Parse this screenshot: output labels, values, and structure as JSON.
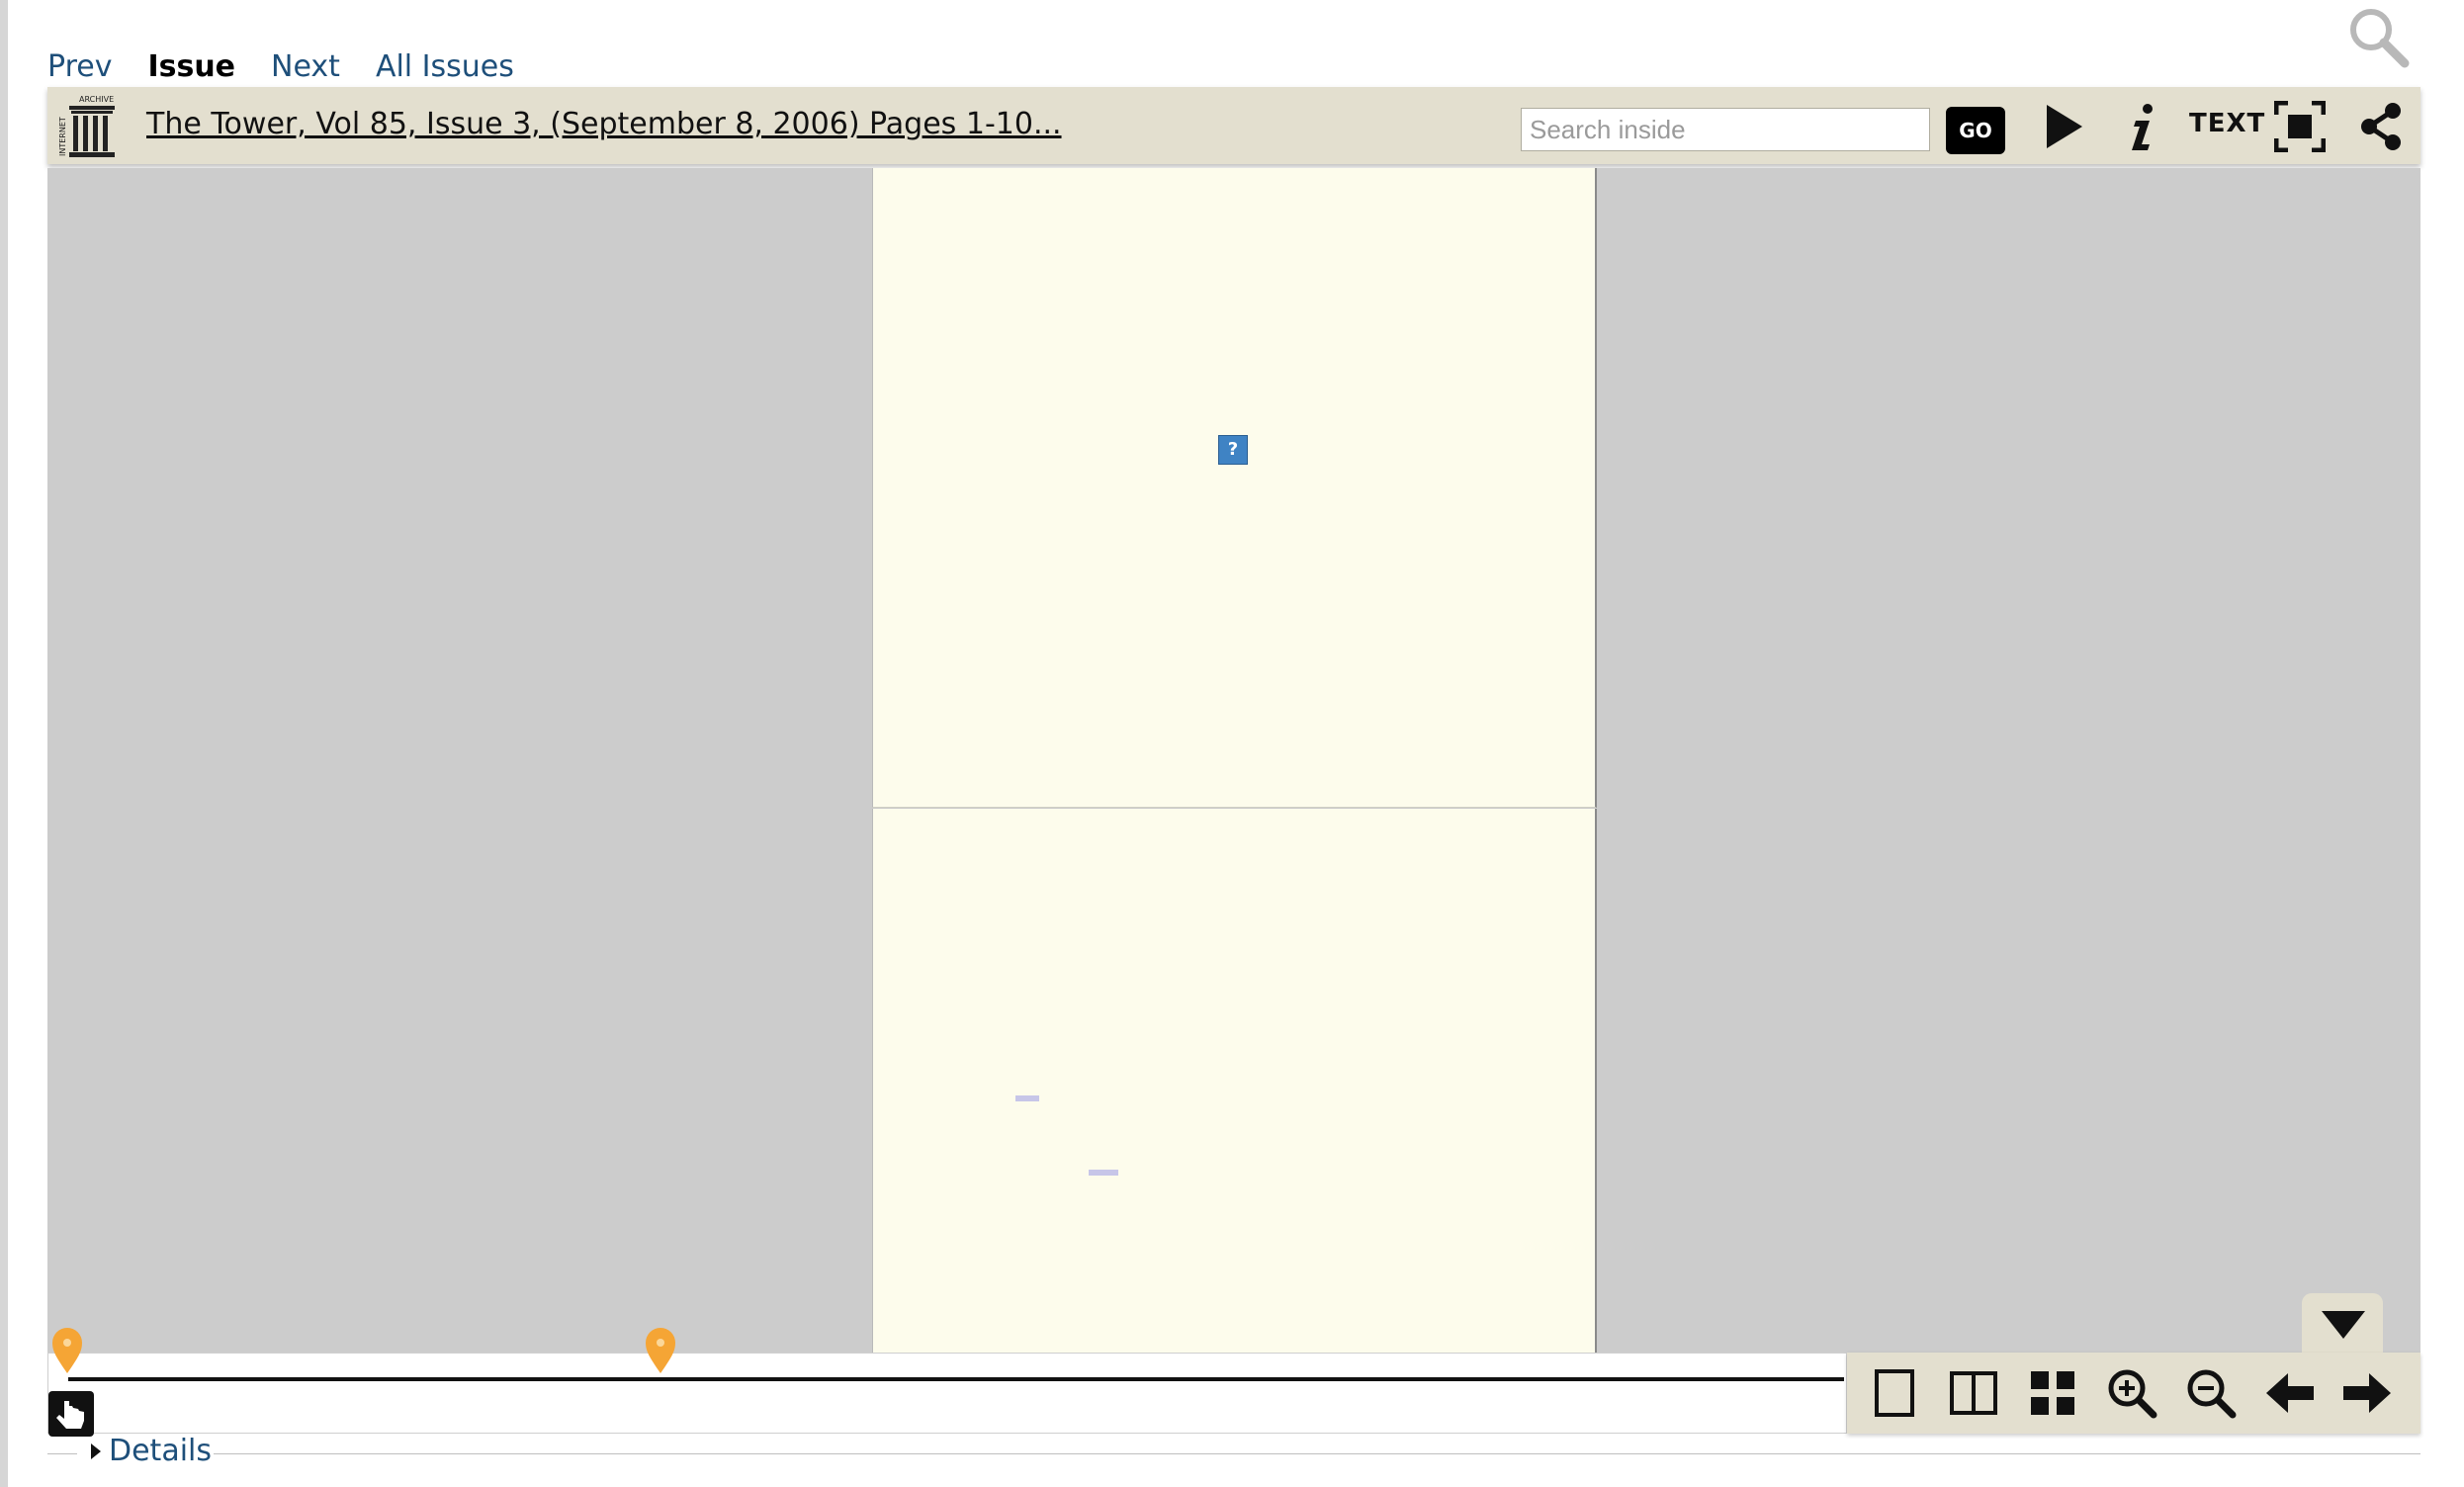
{
  "issue_nav": {
    "prev": "Prev",
    "issue": "Issue",
    "next": "Next",
    "all_issues": "All Issues"
  },
  "toolbar": {
    "logo_text_vertical": "INTERNET",
    "logo_text_top": "ARCHIVE",
    "title": "The Tower, Vol 85, Issue 3, (September 8, 2006) Pages 1-10...",
    "search_placeholder": "Search inside",
    "go_label": "GO",
    "text_label": "TEXT",
    "icons": [
      "play-icon",
      "info-icon",
      "fullscreen-icon",
      "share-icon"
    ]
  },
  "viewer": {
    "missing_image_glyph": "?"
  },
  "navigation": {
    "icons": [
      "one-page-view-icon",
      "two-page-view-icon",
      "thumbnail-view-icon",
      "zoom-in-icon",
      "zoom-out-icon",
      "arrow-left-icon",
      "arrow-right-icon"
    ]
  },
  "footer": {
    "details_label": "Details"
  },
  "colors": {
    "toolbar_bg": "#e3dfcf",
    "viewer_bg": "#cccccc",
    "page_bg": "#fdfcec",
    "link": "#1e4f7a",
    "marker": "#f5a535"
  }
}
